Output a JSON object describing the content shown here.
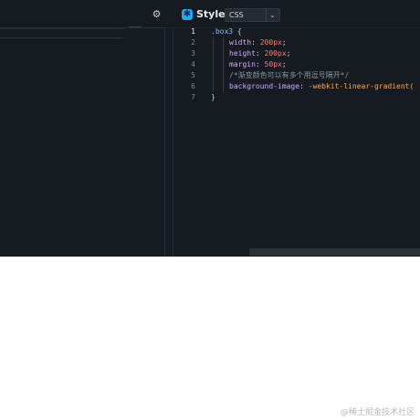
{
  "toolbar": {
    "settings_icon": "gear-icon",
    "style_icon": "style-logo-icon",
    "title": "Style",
    "language": "CSS",
    "dropdown_icon": "chevron-down-icon"
  },
  "editor": {
    "line_numbers": [
      "1",
      "2",
      "3",
      "4",
      "5",
      "6",
      "7"
    ],
    "active_line": "1",
    "code": {
      "l1_selector": ".box3",
      "l1_brace": " {",
      "l2_prop": "width",
      "l2_colon": ": ",
      "l2_num": "200",
      "l2_unit": "px",
      "l2_semi": ";",
      "l3_prop": "height",
      "l3_colon": ": ",
      "l3_num": "200",
      "l3_unit": "px",
      "l3_semi": ";",
      "l4_prop": "margin",
      "l4_colon": ": ",
      "l4_num": "50",
      "l4_unit": "px",
      "l4_semi": ";",
      "l5_comment": "/*渐变颜色可以有多个用逗号隔开*/",
      "l6_prop": "background-image",
      "l6_colon": ": ",
      "l6_value": "-webkit-linear-gradient(",
      "l7_brace": "}"
    }
  },
  "colors": {
    "background": "#161b22",
    "accent": "#2aa3f2"
  },
  "watermark": "@稀土掘金技术社区"
}
